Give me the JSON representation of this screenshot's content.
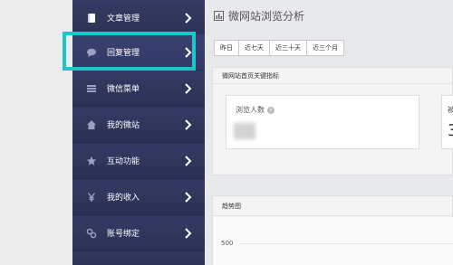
{
  "sidebar": {
    "items": [
      {
        "label": "文章管理",
        "icon": "book-icon"
      },
      {
        "label": "回复管理",
        "icon": "comment-icon"
      },
      {
        "label": "微信菜单",
        "icon": "list-icon"
      },
      {
        "label": "我的微站",
        "icon": "home-icon"
      },
      {
        "label": "互动功能",
        "icon": "star-icon"
      },
      {
        "label": "我的收入",
        "icon": "yen-icon"
      },
      {
        "label": "账号绑定",
        "icon": "link-icon"
      }
    ],
    "active_index": 1,
    "highlight_color": "#1fc6c9"
  },
  "main": {
    "title": "微网站浏览分析",
    "range_tabs": [
      "昨日",
      "近七天",
      "近三十天",
      "近三个月"
    ],
    "kpi_panel": {
      "title": "微网站首页关键指标",
      "card1_label": "浏览人数",
      "card2_label": "被",
      "card2_value": "3"
    },
    "trend_panel": {
      "title": "趋势图",
      "y_tick": "500"
    }
  }
}
